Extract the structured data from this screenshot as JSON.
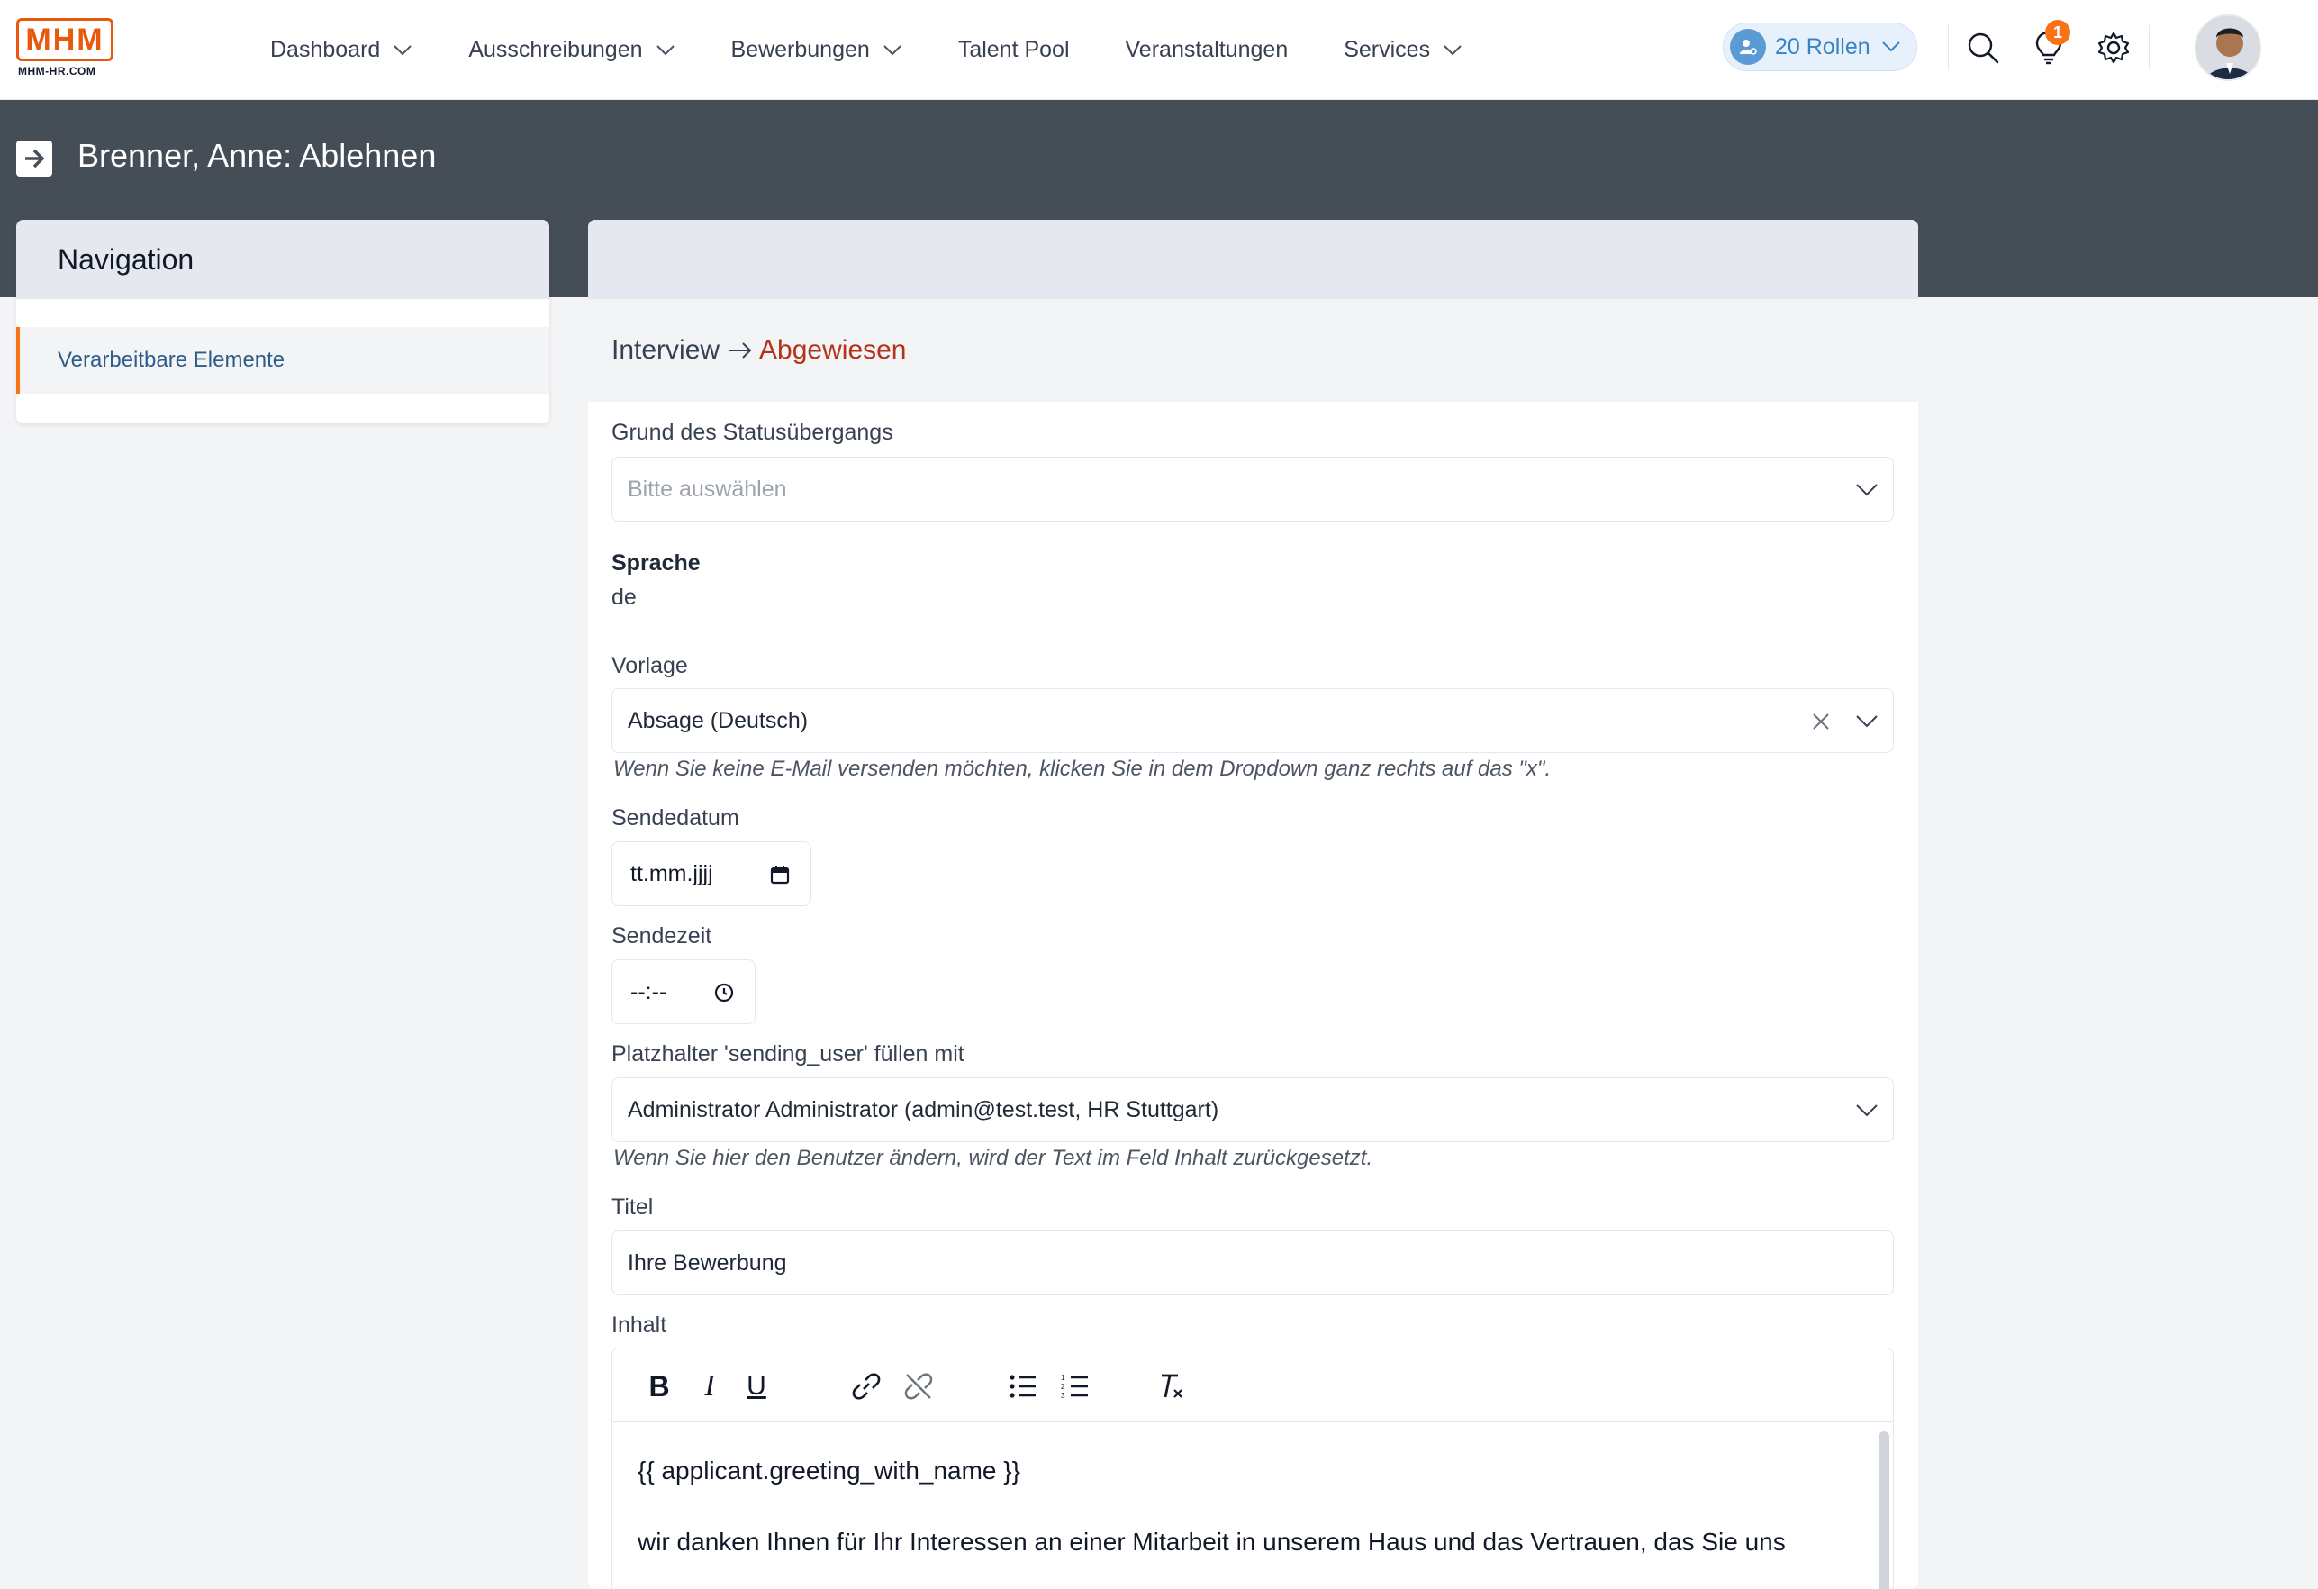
{
  "brand": {
    "logo_text": "MHM",
    "logo_sub": "MHM-HR.COM",
    "accent": "#ea580c"
  },
  "nav": {
    "items": [
      {
        "label": "Dashboard",
        "has_dropdown": true
      },
      {
        "label": "Ausschreibungen",
        "has_dropdown": true
      },
      {
        "label": "Bewerbungen",
        "has_dropdown": true
      },
      {
        "label": "Talent Pool",
        "has_dropdown": false
      },
      {
        "label": "Veranstaltungen",
        "has_dropdown": false
      },
      {
        "label": "Services",
        "has_dropdown": true
      }
    ],
    "roles_label": "20 Rollen",
    "notification_count": "1"
  },
  "page": {
    "title": "Brenner, Anne: Ablehnen"
  },
  "sidebar": {
    "heading": "Navigation",
    "items": [
      {
        "label": "Verarbeitbare Elemente",
        "active": true
      }
    ]
  },
  "form": {
    "transition_from": "Interview",
    "transition_to": "Abgewiesen",
    "reason": {
      "label": "Grund des Statusübergangs",
      "placeholder": "Bitte auswählen"
    },
    "language": {
      "label": "Sprache",
      "value": "de"
    },
    "template": {
      "label": "Vorlage",
      "value": "Absage (Deutsch)",
      "hint": "Wenn Sie keine E-Mail versenden möchten, klicken Sie in dem Dropdown ganz rechts auf das \"x\"."
    },
    "send_date": {
      "label": "Sendedatum",
      "placeholder": "tt.mm.jjjj"
    },
    "send_time": {
      "label": "Sendezeit",
      "placeholder": "--:--"
    },
    "sending_user": {
      "label": "Platzhalter 'sending_user' füllen mit",
      "value": "Administrator Administrator (admin@test.test, HR Stuttgart)",
      "hint": "Wenn Sie hier den Benutzer ändern, wird der Text im Feld Inhalt zurückgesetzt."
    },
    "title": {
      "label": "Titel",
      "value": "Ihre Bewerbung"
    },
    "content": {
      "label": "Inhalt",
      "toolbar": [
        "bold-icon",
        "italic-icon",
        "underline-icon",
        "link-icon",
        "unlink-icon",
        "bullet-list-icon",
        "numbered-list-icon",
        "clear-format-icon"
      ],
      "lines": [
        "{{ applicant.greeting_with_name }}",
        "wir danken Ihnen für Ihr Interessen an einer Mitarbeit in unserem Haus und das Vertrauen, das Sie uns"
      ]
    }
  }
}
